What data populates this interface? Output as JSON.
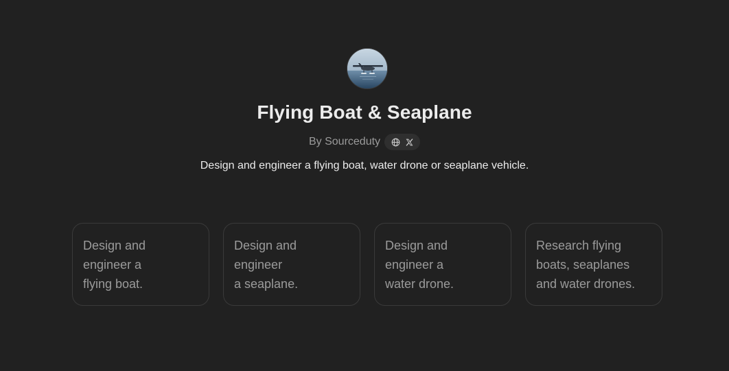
{
  "gpt": {
    "avatar_alt": "Flying Boat & Seaplane",
    "title": "Flying Boat & Seaplane",
    "author_prefix": "By",
    "author": "Sourceduty",
    "description": "Design and engineer a flying boat, water drone or seaplane vehicle.",
    "social_icons": [
      "globe-icon",
      "x-logo-icon"
    ]
  },
  "starters": [
    {
      "text": "Design and\nengineer a\nflying boat."
    },
    {
      "text": "Design and\nengineer\na seaplane."
    },
    {
      "text": "Design and\nengineer a\nwater drone."
    },
    {
      "text": "Research flying\nboats, seaplanes\nand water drones."
    }
  ],
  "colors": {
    "background": "#212121",
    "title_text": "#ececec",
    "muted_text": "#9b9b9b",
    "card_border": "#3a3a3a",
    "pill_background": "#2f2f2f"
  }
}
